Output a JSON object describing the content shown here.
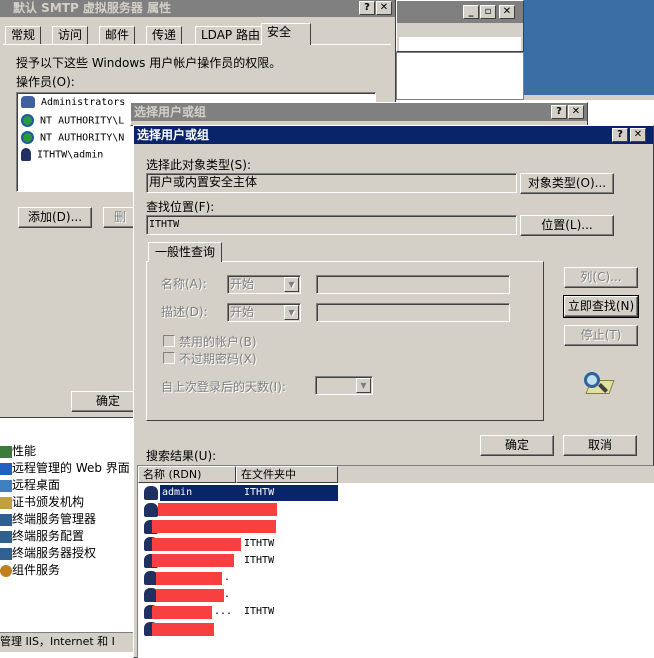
{
  "smtp_window": {
    "title": "默认 SMTP 虚拟服务器 属性",
    "tabs": [
      "常规",
      "访问",
      "邮件",
      "传递",
      "LDAP 路由",
      "安全"
    ],
    "description": "授予以下这些 Windows 用户帐户操作员的权限。",
    "operators_label": "操作员(O):",
    "operators": [
      "Administrators",
      "NT AUTHORITY\\L",
      "NT AUTHORITY\\N",
      "ITHTW\\admin"
    ],
    "add_button": "添加(D)...",
    "remove_button": "删",
    "ok_button": "确定"
  },
  "mmc_tree": {
    "items": [
      "性能",
      "远程管理的 Web 界面",
      "远程桌面",
      "证书颁发机构",
      "终端服务管理器",
      "终端服务配置",
      "终端服务器授权",
      "组件服务"
    ],
    "status": "管理 IIS，Internet 和 I"
  },
  "select_dialog_back": {
    "title": "选择用户或组"
  },
  "select_dialog": {
    "title": "选择用户或组",
    "object_type_label": "选择此对象类型(S):",
    "object_type_value": "用户或内置安全主体",
    "object_type_button": "对象类型(O)...",
    "location_label": "查找位置(F):",
    "location_value": "ITHTW",
    "location_button": "位置(L)...",
    "general_tab": "一般性查询",
    "name_label": "名称(A):",
    "name_combo": "开始",
    "desc_label": "描述(D):",
    "desc_combo": "开始",
    "disabled_accounts": "禁用的帐户(B)",
    "non_expiring": "不过期密码(X)",
    "days_since_logon": "自上次登录后的天数(I):",
    "columns_button": "列(C)...",
    "find_now_button": "立即查找(N)",
    "stop_button": "停止(T)",
    "ok_button": "确定",
    "cancel_button": "取消",
    "results_label": "搜索结果(U):",
    "col_name": "名称 (RDN)",
    "col_folder": "在文件夹中",
    "results": [
      {
        "name": "admin",
        "folder": "ITHTW"
      },
      {
        "name": "",
        "folder": ""
      },
      {
        "name": "",
        "folder": ""
      },
      {
        "name": "",
        "folder": "ITHTW"
      },
      {
        "name": "",
        "folder": "ITHTW"
      },
      {
        "name": ".",
        "folder": ""
      },
      {
        "name": ".",
        "folder": ""
      },
      {
        "name": "...",
        "folder": "ITHTW"
      },
      {
        "name": "",
        "folder": ""
      }
    ]
  },
  "colors": {
    "active_title": "#0a246a",
    "inactive_title": "#808080",
    "face": "#d4d0c8",
    "redaction": "#f94040"
  }
}
